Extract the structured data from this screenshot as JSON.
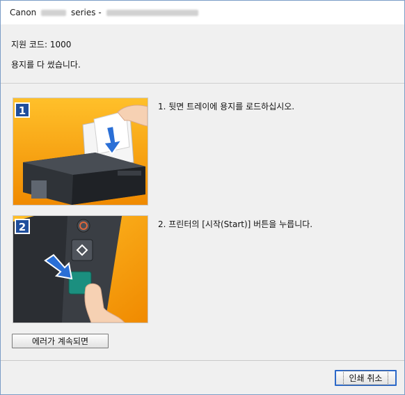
{
  "window": {
    "title_prefix": "Canon",
    "title_model_blurred": "G2010",
    "title_series": "series",
    "title_separator": "-",
    "title_host_blurred": "S-2010-P1008.canonon.net"
  },
  "message": {
    "support_code_line": "지원 코드: 1000",
    "main_text": "용지를 다 썼습니다."
  },
  "steps": [
    {
      "number": "1",
      "text": "1.  뒷면 트레이에 용지를 로드하십시오."
    },
    {
      "number": "2",
      "text": "2.  프린터의 [시작(Start)] 버튼을 누릅니다."
    }
  ],
  "buttons": {
    "if_error_continues": "에러가 계속되면",
    "cancel_print": "인쇄 취소"
  },
  "colors": {
    "orange_bg_top": "#ffb01e",
    "orange_bg_bottom": "#f28c00",
    "step_badge": "#1f4e9c",
    "arrow_blue": "#2a6fd6",
    "start_button_green": "#1b8f7f"
  }
}
